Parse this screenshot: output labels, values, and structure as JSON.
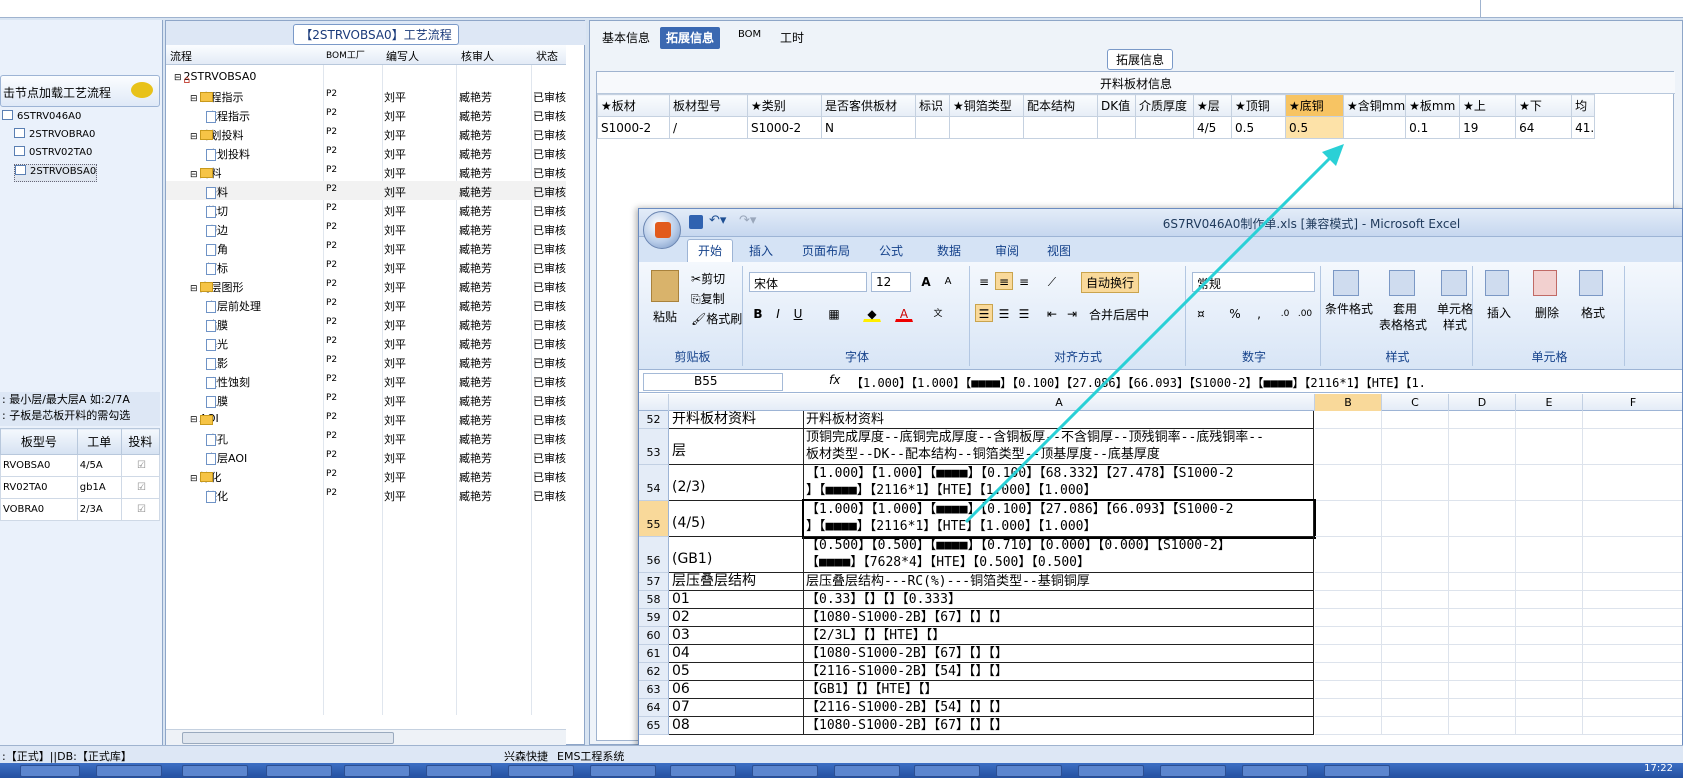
{
  "left_panel": {
    "load_hint": "击节点加载工艺流程",
    "bom_items": [
      "6STRV046A0",
      "2STRVOBRA0",
      "0STRV02TA0",
      "2STRVOBSA0"
    ],
    "info_lines": [
      ": 最小层/最大层A 如:2/7A",
      ": 子板是芯板开料的需勾选"
    ],
    "plank_headers": [
      "板型号",
      "工单",
      "投料"
    ],
    "plank_rows": [
      [
        "RVOBSA0",
        "4/5A",
        "☑"
      ],
      [
        "RV02TA0",
        "gb1A",
        "☑"
      ],
      [
        "VOBRA0",
        "2/3A",
        "☑"
      ]
    ]
  },
  "middle_panel": {
    "title": "【2STRVOBSA0】工艺流程",
    "headers": [
      "流程",
      "BOM工厂",
      "编写人",
      "核审人",
      "状态"
    ],
    "rows": [
      {
        "indent": 0,
        "type": "root",
        "name": "2STRVOBSA0",
        "f": "",
        "w": "",
        "r": "",
        "s": ""
      },
      {
        "indent": 1,
        "type": "folder",
        "name": "流程指示",
        "f": "P2",
        "w": "刘平",
        "r": "臧艳芳",
        "s": "已审核"
      },
      {
        "indent": 2,
        "type": "doc",
        "name": "流程指示",
        "f": "P2",
        "w": "刘平",
        "r": "臧艳芳",
        "s": "已审核"
      },
      {
        "indent": 1,
        "type": "folder",
        "name": "计划投料",
        "f": "P2",
        "w": "刘平",
        "r": "臧艳芳",
        "s": "已审核"
      },
      {
        "indent": 2,
        "type": "doc",
        "name": "计划投料",
        "f": "P2",
        "w": "刘平",
        "r": "臧艳芳",
        "s": "已审核"
      },
      {
        "indent": 1,
        "type": "folder",
        "name": "开料",
        "f": "P2",
        "w": "刘平",
        "r": "臧艳芳",
        "s": "已审核"
      },
      {
        "indent": 2,
        "type": "doc",
        "name": "开料",
        "f": "P2",
        "w": "刘平",
        "r": "臧艳芳",
        "s": "已审核",
        "sel": true
      },
      {
        "indent": 2,
        "type": "doc",
        "name": "裁切",
        "f": "P2",
        "w": "刘平",
        "r": "臧艳芳",
        "s": "已审核"
      },
      {
        "indent": 2,
        "type": "doc",
        "name": "磨边",
        "f": "P2",
        "w": "刘平",
        "r": "臧艳芳",
        "s": "已审核"
      },
      {
        "indent": 2,
        "type": "doc",
        "name": "圆角",
        "f": "P2",
        "w": "刘平",
        "r": "臧艳芳",
        "s": "已审核"
      },
      {
        "indent": 2,
        "type": "doc",
        "name": "打标",
        "f": "P2",
        "w": "刘平",
        "r": "臧艳芳",
        "s": "已审核"
      },
      {
        "indent": 1,
        "type": "folder",
        "name": "内层图形",
        "f": "P2",
        "w": "刘平",
        "r": "臧艳芳",
        "s": "已审核"
      },
      {
        "indent": 2,
        "type": "doc",
        "name": "内层前处理",
        "f": "P2",
        "w": "刘平",
        "r": "臧艳芳",
        "s": "已审核"
      },
      {
        "indent": 2,
        "type": "doc",
        "name": "贴膜",
        "f": "P2",
        "w": "刘平",
        "r": "臧艳芳",
        "s": "已审核"
      },
      {
        "indent": 2,
        "type": "doc",
        "name": "曝光",
        "f": "P2",
        "w": "刘平",
        "r": "臧艳芳",
        "s": "已审核"
      },
      {
        "indent": 2,
        "type": "doc",
        "name": "显影",
        "f": "P2",
        "w": "刘平",
        "r": "臧艳芳",
        "s": "已审核"
      },
      {
        "indent": 2,
        "type": "doc",
        "name": "酸性蚀刻",
        "f": "P2",
        "w": "刘平",
        "r": "臧艳芳",
        "s": "已审核"
      },
      {
        "indent": 2,
        "type": "doc",
        "name": "退膜",
        "f": "P2",
        "w": "刘平",
        "r": "臧艳芳",
        "s": "已审核"
      },
      {
        "indent": 1,
        "type": "folder",
        "name": "AOI",
        "f": "P2",
        "w": "刘平",
        "r": "臧艳芳",
        "s": "已审核"
      },
      {
        "indent": 2,
        "type": "doc",
        "name": "冲孔",
        "f": "P2",
        "w": "刘平",
        "r": "臧艳芳",
        "s": "已审核"
      },
      {
        "indent": 2,
        "type": "doc",
        "name": "内层AOI",
        "f": "P2",
        "w": "刘平",
        "r": "臧艳芳",
        "s": "已审核"
      },
      {
        "indent": 1,
        "type": "folder",
        "name": "棕化",
        "f": "P2",
        "w": "刘平",
        "r": "臧艳芳",
        "s": "已审核"
      },
      {
        "indent": 2,
        "type": "doc",
        "name": "棕化",
        "f": "P2",
        "w": "刘平",
        "r": "臧艳芳",
        "s": "已审核"
      }
    ]
  },
  "right_panel": {
    "tabs": [
      "基本信息",
      "拓展信息",
      "BOM",
      "工时"
    ],
    "active_tab": 1,
    "ext_label": "拓展信息",
    "ext_subtitle": "开料板材信息",
    "ext_headers": [
      "★板材",
      "板材型号",
      "★类别",
      "是否客供板材",
      "标识",
      "★铜箔类型",
      "配本结构",
      "DK值",
      "介质厚度",
      "★层",
      "★顶铜",
      "★底铜",
      "★含铜mm",
      "★板mm",
      "★上",
      "★下",
      "均"
    ],
    "ext_row": [
      "S1000-2",
      "/",
      "S1000-2",
      "N",
      "",
      "",
      "",
      "",
      "",
      "4/5",
      "0.5",
      "0.5",
      "",
      "0.1",
      "19",
      "64",
      "41."
    ],
    "highlight_col": 11
  },
  "excel": {
    "title": "6S7RV046A0制作单.xls  [兼容模式] - Microsoft Excel",
    "ribbon_tabs": [
      "开始",
      "插入",
      "页面布局",
      "公式",
      "数据",
      "审阅",
      "视图"
    ],
    "clipboard": {
      "paste": "粘贴",
      "cut": "剪切",
      "copy": "复制",
      "painter": "格式刷",
      "label": "剪贴板"
    },
    "font": {
      "name": "宋体",
      "size": "12",
      "label": "字体"
    },
    "align": {
      "wrap": "自动换行",
      "merge": "合并后居中",
      "label": "对齐方式"
    },
    "number": {
      "format": "常规",
      "label": "数字"
    },
    "styles": {
      "cond": "条件格式",
      "table": "套用",
      "table2": "表格格式",
      "cell": "单元格",
      "cell2": "样式",
      "label": "样式"
    },
    "cells": {
      "insert": "插入",
      "delete": "删除",
      "format": "格式",
      "label": "单元格"
    },
    "name_box": "B55",
    "formula": "【1.000】【1.000】【■■■■】【0.100】【27.086】【66.093】【S1000-2】【■■■■】【2116*1】【HTE】【1.",
    "columns": [
      "A",
      "B",
      "C",
      "D",
      "E",
      "F"
    ],
    "rows": [
      {
        "n": "52",
        "a": "开料板材资料",
        "b": [
          "开料板材资料"
        ]
      },
      {
        "n": "53",
        "a": "层",
        "b": [
          "顶铜完成厚度--底铜完成厚度--含铜板厚--不含铜厚--顶残铜率--底残铜率--",
          "板材类型--DK--配本结构--铜箔类型--顶基厚度--底基厚度"
        ]
      },
      {
        "n": "54",
        "a": "(2/3)",
        "b": [
          "【1.000】【1.000】【■■■■】【0.100】【68.332】【27.478】【S1000-2",
          "】【■■■■】【2116*1】【HTE】【1.000】【1.000】"
        ]
      },
      {
        "n": "55",
        "a": "(4/5)",
        "b": [
          "【1.000】【1.000】【■■■■】【0.100】【27.086】【66.093】【S1000-2",
          "】【■■■■】【2116*1】【HTE】【1.000】【1.000】"
        ],
        "sel": true
      },
      {
        "n": "56",
        "a": "(GB1)",
        "b": [
          "【0.500】【0.500】【■■■■】【0.710】【0.000】【0.000】【S1000-2】",
          "【■■■■】【7628*4】【HTE】【0.500】【0.500】"
        ]
      },
      {
        "n": "57",
        "a": "层压叠层结构",
        "b": [
          "层压叠层结构---RC(%)---铜箔类型--基铜铜厚"
        ]
      },
      {
        "n": "58",
        "a": "01",
        "b": [
          "【0.33】【】【】【0.333】"
        ]
      },
      {
        "n": "59",
        "a": "02",
        "b": [
          "【1080-S1000-2B】【67】【】【】"
        ]
      },
      {
        "n": "60",
        "a": "03",
        "b": [
          "【2/3L】【】【HTE】【】"
        ]
      },
      {
        "n": "61",
        "a": "04",
        "b": [
          "【1080-S1000-2B】【67】【】【】"
        ]
      },
      {
        "n": "62",
        "a": "05",
        "b": [
          "【2116-S1000-2B】【54】【】【】"
        ]
      },
      {
        "n": "63",
        "a": "06",
        "b": [
          "【GB1】【】【HTE】【】"
        ]
      },
      {
        "n": "64",
        "a": "07",
        "b": [
          "【2116-S1000-2B】【54】【】【】"
        ]
      },
      {
        "n": "65",
        "a": "08",
        "b": [
          "【1080-S1000-2B】【67】【】【】"
        ]
      }
    ]
  },
  "statusbar": {
    "left": ":【正式】||DB:【正式库】",
    "brand": "兴森快捷",
    "system": "EMS工程系统"
  },
  "taskbar": {
    "clock": "17:22"
  },
  "colors": {
    "accent": "#3a68b1",
    "highlight": "#f7c463",
    "arrow": "#2ad0d6"
  }
}
